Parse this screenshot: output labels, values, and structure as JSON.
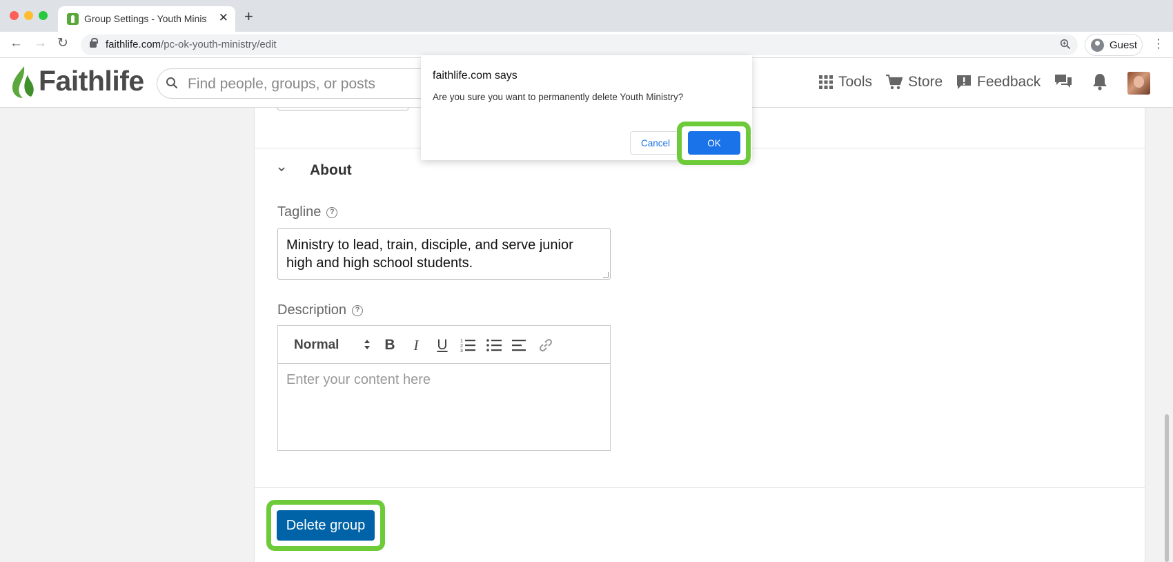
{
  "browser": {
    "tab_title": "Group Settings - Youth Ministry",
    "tab_close": "✕",
    "new_tab": "+",
    "url_domain": "faithlife.com",
    "url_path": "/pc-ok-youth-ministry/edit",
    "guest_label": "Guest"
  },
  "header": {
    "logo_text": "Faithlife",
    "search_placeholder": "Find people, groups, or posts",
    "nav": {
      "tools": "Tools",
      "store": "Store",
      "feedback": "Feedback"
    }
  },
  "about": {
    "section_title": "About",
    "tagline_label": "Tagline",
    "tagline_value": "Ministry to lead, train, disciple, and serve junior high and high school students.",
    "description_label": "Description",
    "editor": {
      "format_select": "Normal",
      "bold": "B",
      "italic": "I",
      "underline": "U",
      "placeholder": "Enter your content here"
    }
  },
  "actions": {
    "delete_label": "Delete group"
  },
  "dialog": {
    "title": "faithlife.com says",
    "message": "Are you sure you want to permanently delete Youth Ministry?",
    "cancel_label": "Cancel",
    "ok_label": "OK"
  },
  "colors": {
    "brand_green": "#5aa83c",
    "delete_button": "#0063a7",
    "dialog_ok": "#1a73e8",
    "highlight": "#6dcb39"
  }
}
